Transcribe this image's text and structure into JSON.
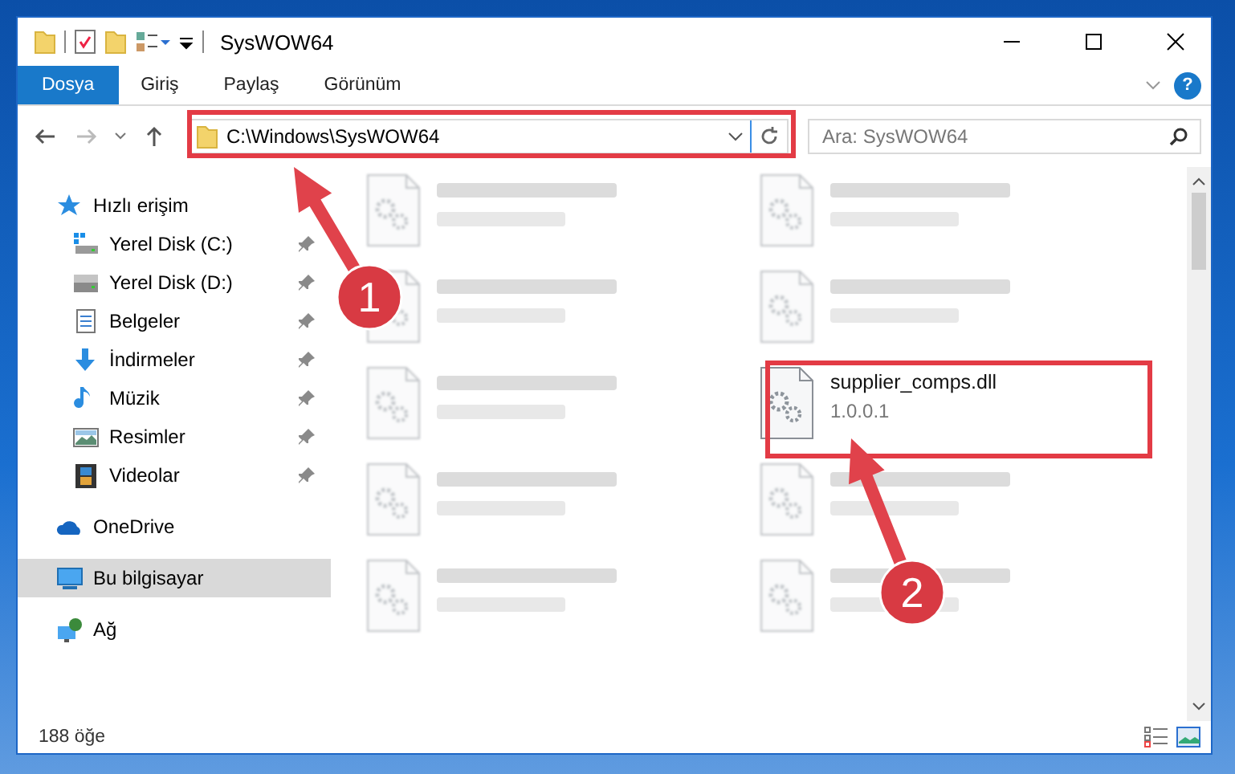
{
  "window": {
    "title": "SysWOW64"
  },
  "ribbon": {
    "tabs": [
      {
        "label": "Dosya",
        "selected": true
      },
      {
        "label": "Giriş",
        "selected": false
      },
      {
        "label": "Paylaş",
        "selected": false
      },
      {
        "label": "Görünüm",
        "selected": false
      }
    ],
    "help": "?"
  },
  "address": {
    "path": "C:\\Windows\\SysWOW64"
  },
  "search": {
    "placeholder": "Ara: SysWOW64"
  },
  "nav": [
    {
      "label": "Hızlı erişim",
      "kind": "star",
      "selected": false,
      "children": [
        {
          "label": "Yerel Disk (C:)",
          "kind": "windrive",
          "pinned": true
        },
        {
          "label": "Yerel Disk (D:)",
          "kind": "drive",
          "pinned": true
        },
        {
          "label": "Belgeler",
          "kind": "document",
          "pinned": true
        },
        {
          "label": "İndirmeler",
          "kind": "download",
          "pinned": true
        },
        {
          "label": "Müzik",
          "kind": "music",
          "pinned": true
        },
        {
          "label": "Resimler",
          "kind": "pictures",
          "pinned": true
        },
        {
          "label": "Videolar",
          "kind": "video",
          "pinned": true
        }
      ]
    },
    {
      "label": "OneDrive",
      "kind": "cloud",
      "selected": false
    },
    {
      "label": "Bu bilgisayar",
      "kind": "computer",
      "selected": true
    },
    {
      "label": "Ağ",
      "kind": "network",
      "selected": false
    }
  ],
  "files": [
    {
      "blurred": true
    },
    {
      "blurred": true
    },
    {
      "blurred": true
    },
    {
      "blurred": true
    },
    {
      "blurred": true
    },
    {
      "blurred": false,
      "name": "supplier_comps.dll",
      "detail": "1.0.0.1"
    },
    {
      "blurred": true
    },
    {
      "blurred": true
    },
    {
      "blurred": true
    },
    {
      "blurred": true
    }
  ],
  "status_bar": {
    "count": "188 öğe"
  },
  "annotations": [
    {
      "label": "1"
    },
    {
      "label": "2"
    }
  ]
}
